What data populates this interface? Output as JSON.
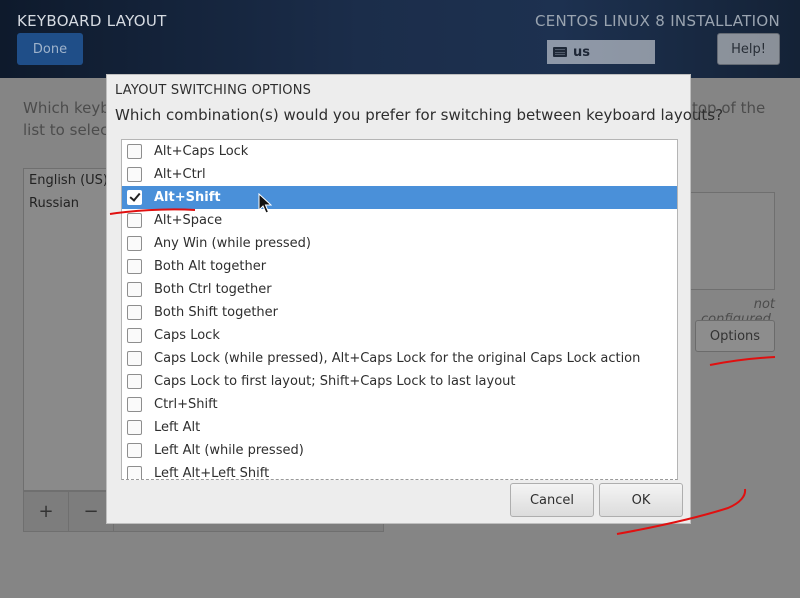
{
  "header": {
    "page_title": "KEYBOARD LAYOUT",
    "done_label": "Done",
    "install_title": "CENTOS LINUX 8 INSTALLATION",
    "layout_indicator": "us",
    "help_label": "Help!"
  },
  "background": {
    "intro_left_line1": "Which keyb",
    "intro_left_line2": "list to select",
    "intro_right_line1": "top of the",
    "layouts": [
      "English (US)",
      "Russian"
    ],
    "add_label": "+",
    "remove_label": "−",
    "not_configured": "not configured.",
    "options_label": "Options"
  },
  "dialog": {
    "title": "LAYOUT SWITCHING OPTIONS",
    "question": "Which combination(s) would you prefer for switching between keyboard layouts?",
    "options": [
      {
        "label": "Alt+Caps Lock",
        "checked": false
      },
      {
        "label": "Alt+Ctrl",
        "checked": false
      },
      {
        "label": "Alt+Shift",
        "checked": true
      },
      {
        "label": "Alt+Space",
        "checked": false
      },
      {
        "label": "Any Win (while pressed)",
        "checked": false
      },
      {
        "label": "Both Alt together",
        "checked": false
      },
      {
        "label": "Both Ctrl together",
        "checked": false
      },
      {
        "label": "Both Shift together",
        "checked": false
      },
      {
        "label": "Caps Lock",
        "checked": false
      },
      {
        "label": "Caps Lock (while pressed), Alt+Caps Lock for the original Caps Lock action",
        "checked": false
      },
      {
        "label": "Caps Lock to first layout; Shift+Caps Lock to last layout",
        "checked": false
      },
      {
        "label": "Ctrl+Shift",
        "checked": false
      },
      {
        "label": "Left Alt",
        "checked": false
      },
      {
        "label": "Left Alt (while pressed)",
        "checked": false
      },
      {
        "label": "Left Alt+Left Shift",
        "checked": false
      }
    ],
    "cancel_label": "Cancel",
    "ok_label": "OK"
  },
  "colors": {
    "selection": "#4a90d9",
    "annotation": "#e01010",
    "done_button": "#1f4e88"
  }
}
